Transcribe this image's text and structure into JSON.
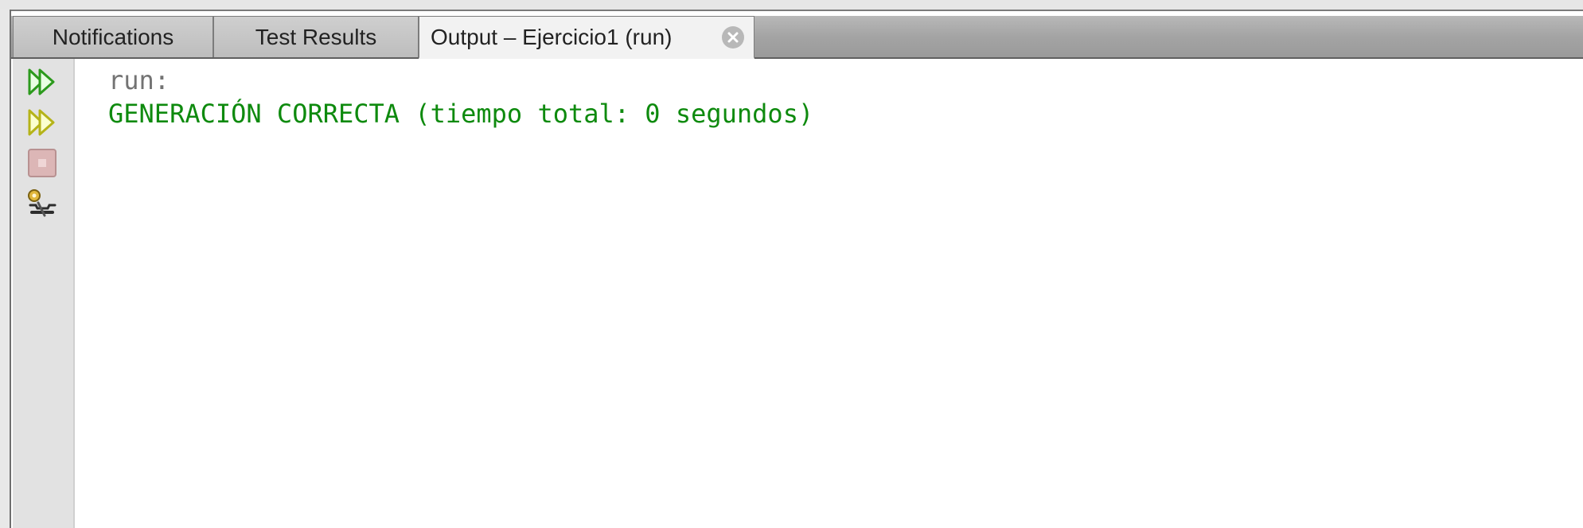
{
  "tabs": [
    {
      "label": "Notifications"
    },
    {
      "label": "Test Results"
    },
    {
      "label": "Output – Ejercicio1 (run)",
      "active": true
    }
  ],
  "toolbar": {
    "icons": [
      "rerun-icon",
      "rerun-with-args-icon",
      "stop-icon",
      "settings-icon"
    ]
  },
  "console": {
    "lines": [
      {
        "text": "run:",
        "color": "#737373"
      },
      {
        "text": "GENERACIÓN CORRECTA (tiempo total: 0 segundos)",
        "color": "#0e8a0e"
      }
    ]
  }
}
